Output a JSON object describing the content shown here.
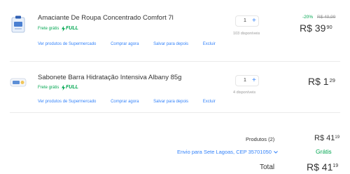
{
  "items": [
    {
      "title": "Amaciante De Roupa Concentrado Comfort 7l",
      "shipping_label": "Frete grátis",
      "full_label": "FULL",
      "actions": [
        "Ver produtos de Supermercado",
        "Comprar agora",
        "Salvar para depois",
        "Excluir"
      ],
      "quantity": "1",
      "plus": "+",
      "available": "103 disponíveis",
      "discount": "-20%",
      "original_price": "R$ 49,99",
      "price_int": "R$ 39",
      "price_cents": "90"
    },
    {
      "title": "Sabonete Barra Hidratação Intensiva Albany 85g",
      "shipping_label": "Frete grátis",
      "full_label": "FULL",
      "actions": [
        "Ver produtos de Supermercado",
        "Comprar agora",
        "Salvar para depois",
        "Excluir"
      ],
      "quantity": "1",
      "plus": "+",
      "available": "4 disponíveis",
      "price_int": "R$ 1",
      "price_cents": "29"
    }
  ],
  "summary": {
    "products_label": "Produtos (2)",
    "products_int": "R$ 41",
    "products_cents": "19",
    "shipping_link": "Envio para Sete Lagoas, CEP 35701050",
    "shipping_value": "Grátis",
    "total_label": "Total",
    "total_int": "R$ 41",
    "total_cents": "19"
  },
  "colors": {
    "link": "#3483fa",
    "green": "#00a650",
    "text": "#333333",
    "muted": "#999999"
  },
  "icons": {
    "chevron": "chevron-down-icon",
    "bolt": "lightning-bolt-icon"
  }
}
